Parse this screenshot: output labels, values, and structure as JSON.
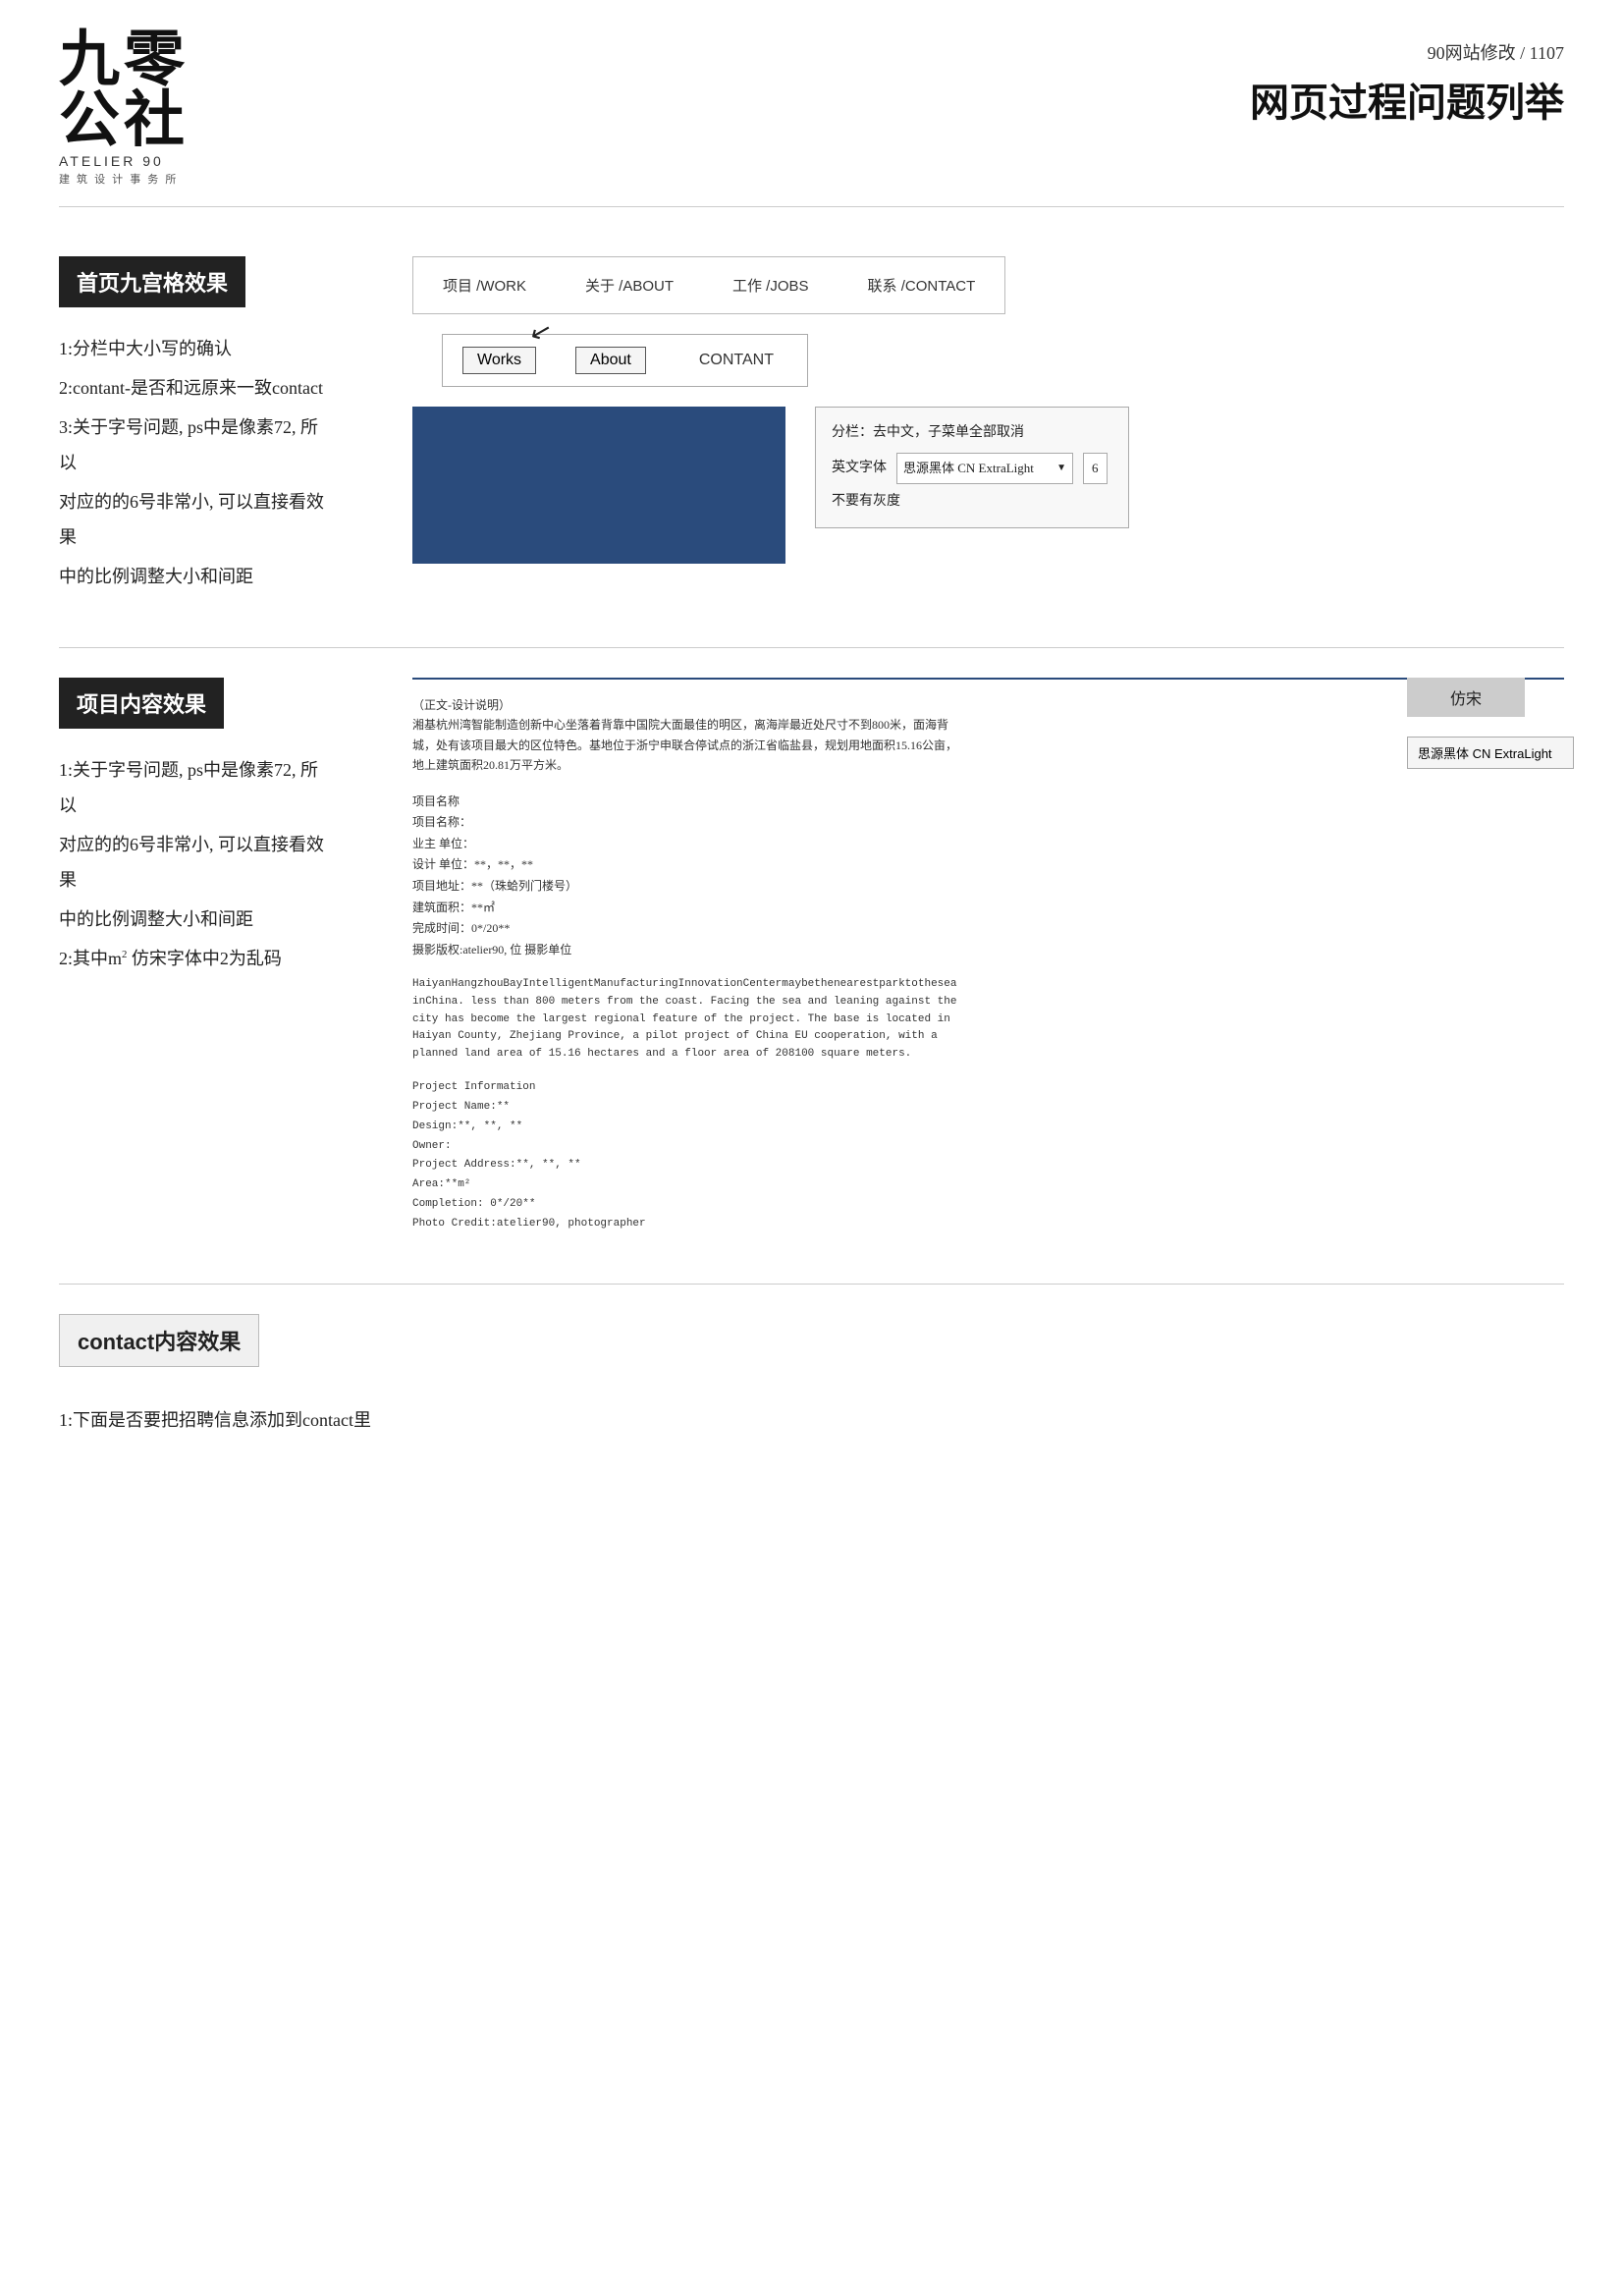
{
  "header": {
    "logo_chinese": "九零\n公社",
    "logo_line1": "九零",
    "logo_line2": "公社",
    "logo_english": "ATELIER 90",
    "logo_subtitle": "建 筑 设 计 事 务 所",
    "subtitle": "90网站修改 / 1107",
    "title": "网页过程问题列举"
  },
  "section1": {
    "label": "首页九宫格效果",
    "notes": [
      "1:分栏中大小写的确认",
      "2:contant-是否和远原来一致contact",
      "3:关于字号问题, ps中是像素72, 所以",
      "对应的的6号非常小, 可以直接看效果",
      "中的比例调整大小和间距"
    ],
    "nav": {
      "items": [
        {
          "label": "项目 /WORK"
        },
        {
          "label": "关于 /ABOUT"
        },
        {
          "label": "工作 /JOBS"
        },
        {
          "label": "联系 /CONTACT"
        }
      ]
    },
    "nav_buttons": [
      {
        "label": "Works",
        "active": true
      },
      {
        "label": "About",
        "active": true
      },
      {
        "label": "CONTANT",
        "active": false
      }
    ],
    "annotation": {
      "line1": "分栏：去中文，子菜单全部取消",
      "line2": "英文字体",
      "line3": "不要有灰度",
      "font_name": "思源黑体 CN ExtraLight",
      "font_size": "6"
    }
  },
  "section2": {
    "label": "项目内容效果",
    "notes": [
      "1:关于字号问题, ps中是像素72, 所以",
      "对应的的6号非常小, 可以直接看效果",
      "中的比例调整大小和间距",
      "2:其中m² 仿宋字体中2为乱码"
    ],
    "project_header_cn": "（正文-设计说明）\n湘基杭州湾智能制造创新中心坐落着背靠中国院大面最佳的明区，离海岸最近处尺寸不到800米，面海背城，处有该项目最大的区位特色。基地位于浙宁申联合停试点的浙江省临盐县，规划用地面积15.16公亩，地上建筑面积20.81万平方米。",
    "project_info_cn": "项目名称\n项目名称：\n业主 单位：\n设计 单位：**，**，**\n项目地址：**(珠蛤列门楼号)\n建筑面积：**㎡\n完成时间：0*/20**\n摄影版权:atelier90, 位 摄影单位",
    "project_text_en": "HaiyanHangzhouBayIntelligentManufacturingInnovationCentermaybethenearestparktothesea​inChina. less than 800 meters from the coast. Facing the sea and leaning against the city has become the largest regional feature of the project. The base is located in Haiyan County, Zhejiang Province, a pilot project of China EU cooperation, with a planned land area of 15.16 hectares and a floor area of 208100 square meters.",
    "project_info_en": "Project Information\nProject Name:**\nDesign:**, **, **\nOwner:\nProject Address:**, **, **\nArea:**m²\nCompletion: 0*/20**\nPhoto Credit:atelier90, photographer",
    "side_label1": "仿宋",
    "side_label2": "思源黑体 CN ExtraLight"
  },
  "section3": {
    "label": "contact内容效果",
    "notes": [
      "1:下面是否要把招聘信息添加到contact里"
    ]
  }
}
